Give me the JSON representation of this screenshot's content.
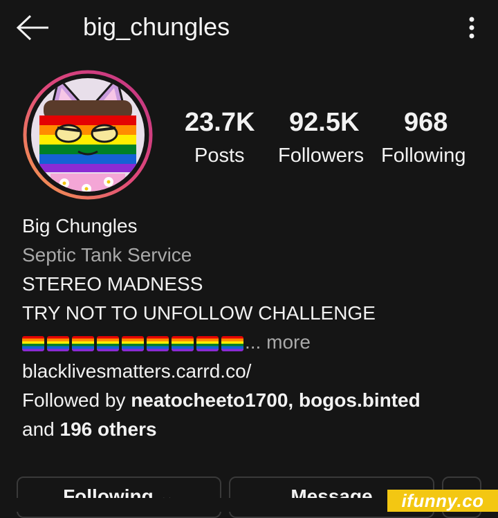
{
  "header": {
    "username": "big_chungles",
    "back_icon": "arrow-left-icon",
    "menu_icon": "more-vertical-icon"
  },
  "profile": {
    "avatar_icon": "cat-with-pride-flag-avatar"
  },
  "stats": [
    {
      "value": "23.7K",
      "label": "Posts"
    },
    {
      "value": "92.5K",
      "label": "Followers"
    },
    {
      "value": "968",
      "label": "Following"
    }
  ],
  "bio": {
    "name": "Big Chungles",
    "category": "Septic Tank Service",
    "line1": "STEREO MADNESS",
    "line2": "TRY NOT TO UNFOLLOW CHALLENGE",
    "flags_count": 9,
    "ellipsis": "...",
    "more_label": "more",
    "link": "blacklivesmatters.carrd.co/",
    "followed_by_prefix": "Followed by ",
    "followed_by_names": "neatocheeto1700, bogos.binted",
    "followed_by_suffix_and": "and",
    "followed_by_others": "196 others"
  },
  "buttons": {
    "following": "Following ⌄",
    "message": "Message",
    "chevron": "⌄"
  },
  "watermark": "ifunny.co",
  "colors": {
    "background": "#151515",
    "text": "#f2f2f2",
    "secondary": "#a9a9a9",
    "watermark": "#f3c712"
  }
}
